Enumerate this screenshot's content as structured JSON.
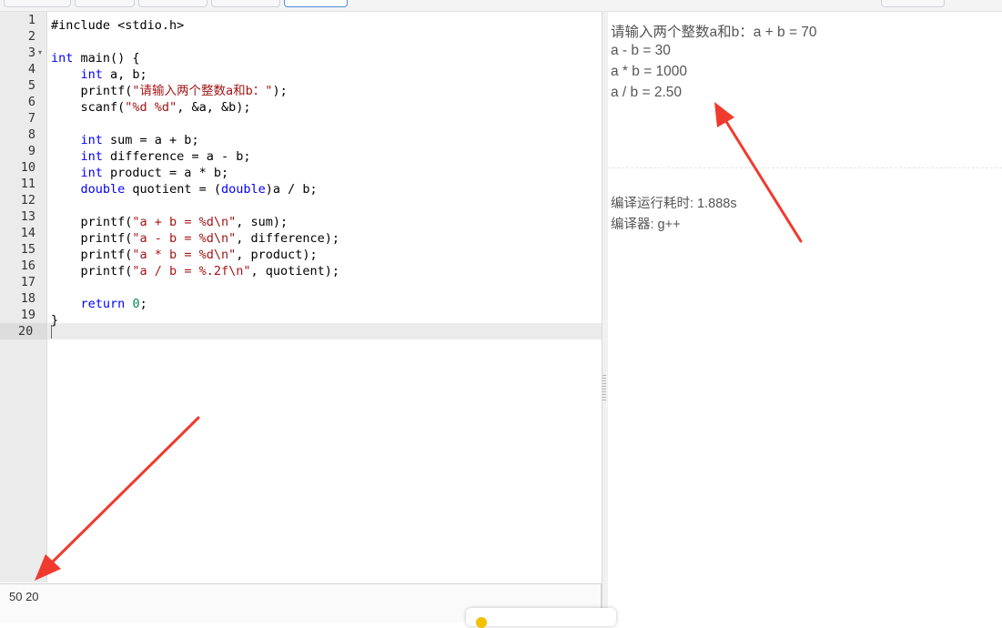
{
  "editor": {
    "line_numbers": [
      "1",
      "2",
      "3",
      "4",
      "5",
      "6",
      "7",
      "8",
      "9",
      "10",
      "11",
      "12",
      "13",
      "14",
      "15",
      "16",
      "17",
      "18",
      "19",
      "20"
    ],
    "code": {
      "l1": "#include <stdio.h>",
      "l3_kw": "int",
      "l3_rest": " main() {",
      "l4_kw": "int",
      "l4_rest": " a, b;",
      "l5_a": "printf(",
      "l5_str": "\"请输入两个整数a和b：\"",
      "l5_b": ");",
      "l6_a": "scanf(",
      "l6_str": "\"%d %d\"",
      "l6_b": ", &a, &b);",
      "l8_kw": "int",
      "l8_rest": " sum = a + b;",
      "l9_kw": "int",
      "l9_rest": " difference = a - b;",
      "l10_kw": "int",
      "l10_rest": " product = a * b;",
      "l11_kw": "double",
      "l11_a": " quotient = (",
      "l11_kw2": "double",
      "l11_b": ")a / b;",
      "l13_a": "printf(",
      "l13_str": "\"a + b = %d\\n\"",
      "l13_b": ", sum);",
      "l14_a": "printf(",
      "l14_str": "\"a - b = %d\\n\"",
      "l14_b": ", difference);",
      "l15_a": "printf(",
      "l15_str": "\"a * b = %d\\n\"",
      "l15_b": ", product);",
      "l16_a": "printf(",
      "l16_str": "\"a / b = %.2f\\n\"",
      "l16_b": ", quotient);",
      "l18_kw": "return",
      "l18_num": "0",
      "l18_b": ";",
      "l19": "}"
    }
  },
  "input": {
    "value": "50 20"
  },
  "output": {
    "lines": [
      "请输入两个整数a和b：a + b = 70",
      "a - b = 30",
      "a * b = 1000",
      "a / b = 2.50"
    ],
    "compile_time": "编译运行耗时: 1.888s",
    "compiler": "编译器: g++"
  },
  "colors": {
    "annotation_arrow": "#f03a2e",
    "keyword": "#0000ff",
    "string": "#a31515"
  }
}
